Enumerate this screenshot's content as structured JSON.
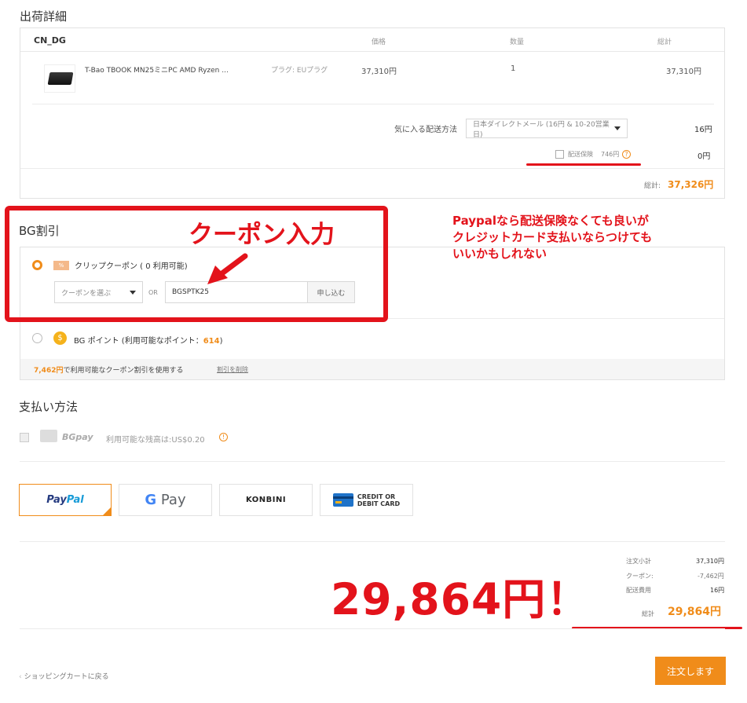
{
  "shipment": {
    "title": "出荷詳細",
    "warehouse": "CN_DG",
    "col_price": "価格",
    "col_qty": "数量",
    "col_total": "総計",
    "product_name": "T-Bao TBOOK MN25ミニPC AMD Ryzen ...",
    "plug": "プラグ: EUプラグ",
    "price": "37,310円",
    "qty": "1",
    "line_total": "37,310円",
    "shipping_label": "気に入る配送方法",
    "shipping_option": "日本ダイレクトメール (16円 & 10-20営業日)",
    "shipping_cost": "16円",
    "insurance_label": "配送保険",
    "insurance_price": "746円",
    "insurance_cost": "0円",
    "subtotal_label": "総計:",
    "subtotal_value": "37,326円"
  },
  "coupon": {
    "title": "BG割引",
    "clip_label": "クリップクーポン ( 0 利用可能)",
    "coupon_icon": "%",
    "select_placeholder": "クーポンを選ぶ",
    "or": "OR",
    "code": "BGSPTK25",
    "apply": "申し込む",
    "points_label": "BG ポイント (利用可能なポイント：",
    "points_value": "614",
    "points_close": ")",
    "used_amount": "7,462円",
    "used_text": "で利用可能なクーポン割引を使用する",
    "remove": "割引を削除"
  },
  "annotations": {
    "coupon_input": "クーポン入力",
    "note_line1": "Paypalなら配送保険なくても良いが",
    "note_line2": "クレジットカード支払いならつけても",
    "note_line3": "いいかもしれない",
    "big_total": "29,864円！"
  },
  "payment": {
    "title": "支払い方法",
    "bgpay": "BGpay",
    "balance": "利用可能な残高は:US$0.20",
    "methods": [
      "PayPal",
      "G Pay",
      "KONBINI",
      "CREDIT OR DEBIT CARD"
    ],
    "paypal_pay": "Pay",
    "paypal_pal": "Pal",
    "gpay_g": "G",
    "gpay_pay": "Pay",
    "konbini": "KONBINI",
    "card_line1": "CREDIT OR",
    "card_line2": "DEBIT CARD"
  },
  "summary": {
    "subtotal_label": "注文小計",
    "subtotal": "37,310円",
    "coupon_label": "クーポン:",
    "coupon": "-7,462円",
    "shipping_label": "配送費用",
    "shipping": "16円",
    "total_label": "総計",
    "total": "29,864円"
  },
  "footer": {
    "back": "ショッピングカートに戻る",
    "order": "注文します"
  },
  "colors": {
    "accent": "#f08c1a",
    "annotation_red": "#e3131b"
  }
}
